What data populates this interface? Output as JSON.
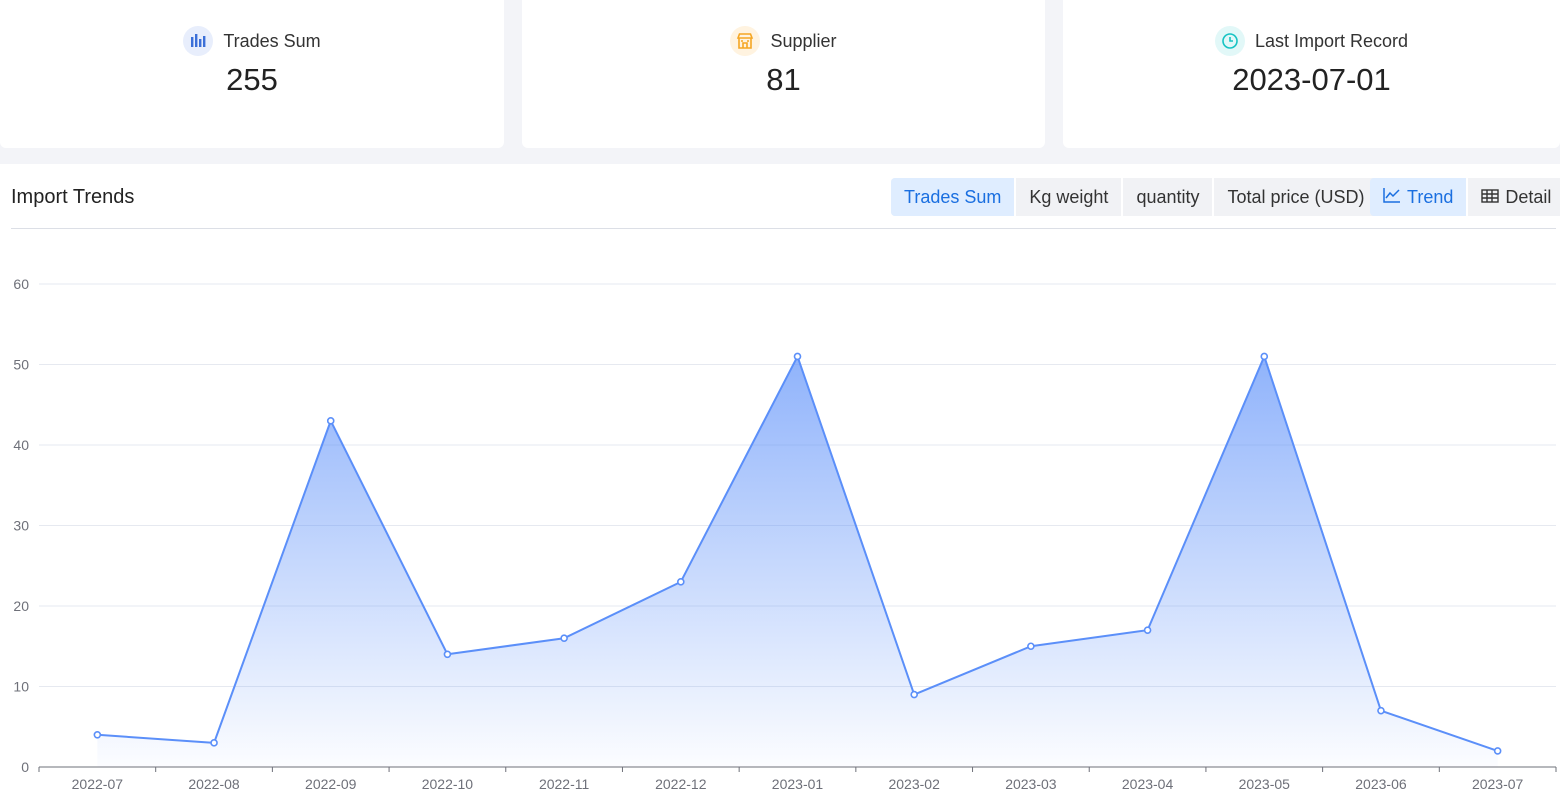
{
  "summary": {
    "trades_sum": {
      "label": "Trades Sum",
      "value": "255"
    },
    "supplier": {
      "label": "Supplier",
      "value": "81"
    },
    "last_import": {
      "label": "Last Import Record",
      "value": "2023-07-01"
    }
  },
  "panel": {
    "title": "Import Trends",
    "metric_tabs": [
      "Trades Sum",
      "Kg weight",
      "quantity",
      "Total price (USD)"
    ],
    "active_metric": "Trades Sum",
    "view_tabs": [
      "Trend",
      "Detail"
    ],
    "active_view": "Trend"
  },
  "colors": {
    "line": "#5b8ff9",
    "trades_icon": "#3b6fd8",
    "supplier_icon": "#f5a623",
    "clock_icon": "#16c3c3",
    "active_tab_text": "#1a6fe0",
    "active_tab_bg": "#dfedff"
  },
  "chart_data": {
    "type": "area",
    "categories": [
      "2022-07",
      "2022-08",
      "2022-09",
      "2022-10",
      "2022-11",
      "2022-12",
      "2023-01",
      "2023-02",
      "2023-03",
      "2023-04",
      "2023-05",
      "2023-06",
      "2023-07"
    ],
    "values": [
      4,
      3,
      43,
      14,
      16,
      23,
      51,
      9,
      15,
      17,
      51,
      7,
      2
    ],
    "ylim": [
      0,
      60
    ],
    "yticks": [
      0,
      10,
      20,
      30,
      40,
      50,
      60
    ],
    "grid": true,
    "title": "",
    "xlabel": "",
    "ylabel": ""
  }
}
